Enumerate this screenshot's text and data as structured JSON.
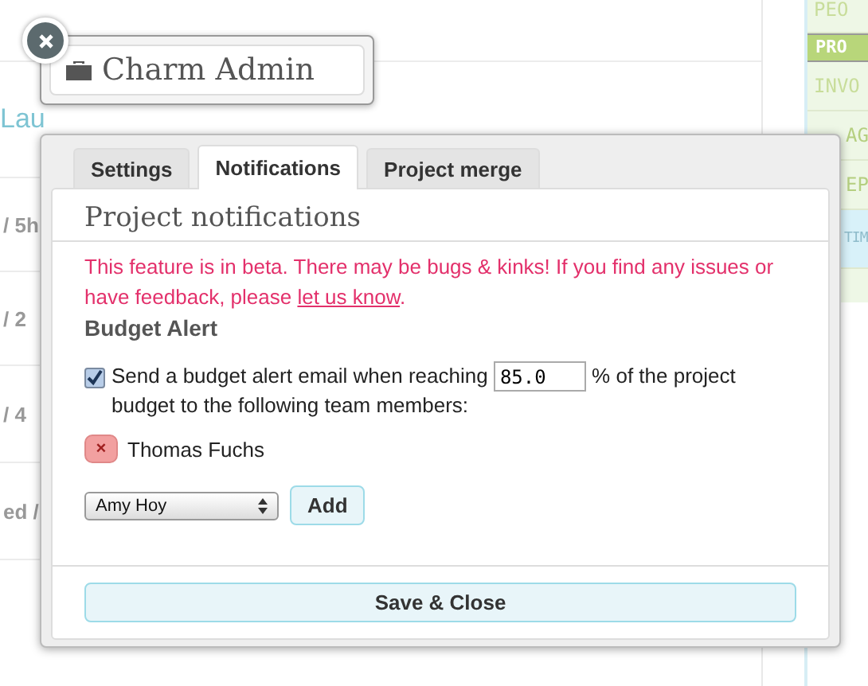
{
  "background": {
    "left_fragments": [
      "Lau",
      "/ 5h",
      "/ 2",
      "/ 4",
      "ed /"
    ],
    "sidebar": [
      {
        "label": "PEO",
        "selected": false
      },
      {
        "label": "PRO",
        "selected": true
      },
      {
        "label": "INVO",
        "selected": false
      },
      {
        "label": "AG",
        "selected": false,
        "kind": "shifted"
      },
      {
        "label": "EP",
        "selected": false,
        "kind": "shifted"
      },
      {
        "label": "TIM",
        "selected": false,
        "kind": "highlight"
      }
    ]
  },
  "charm_admin": {
    "title": "Charm Admin"
  },
  "dialog": {
    "tabs": [
      {
        "label": "Settings",
        "selected": false
      },
      {
        "label": "Notifications",
        "selected": true
      },
      {
        "label": "Project merge",
        "selected": false
      }
    ],
    "heading": "Project notifications",
    "beta_notice": "This feature is in beta. There may be bugs & kinks! If you find any issues or have feedback, please ",
    "beta_link": "let us know",
    "beta_end": ".",
    "section_title": "Budget Alert",
    "alert": {
      "checked": true,
      "text_before": "Send a budget alert email when reaching",
      "threshold": "85.0",
      "text_after": "% of the project budget to the following team members:"
    },
    "members": [
      {
        "name": "Thomas Fuchs",
        "remove": "×"
      }
    ],
    "member_select": "Amy Hoy",
    "add_button": "Add",
    "save_button": "Save & Close"
  }
}
